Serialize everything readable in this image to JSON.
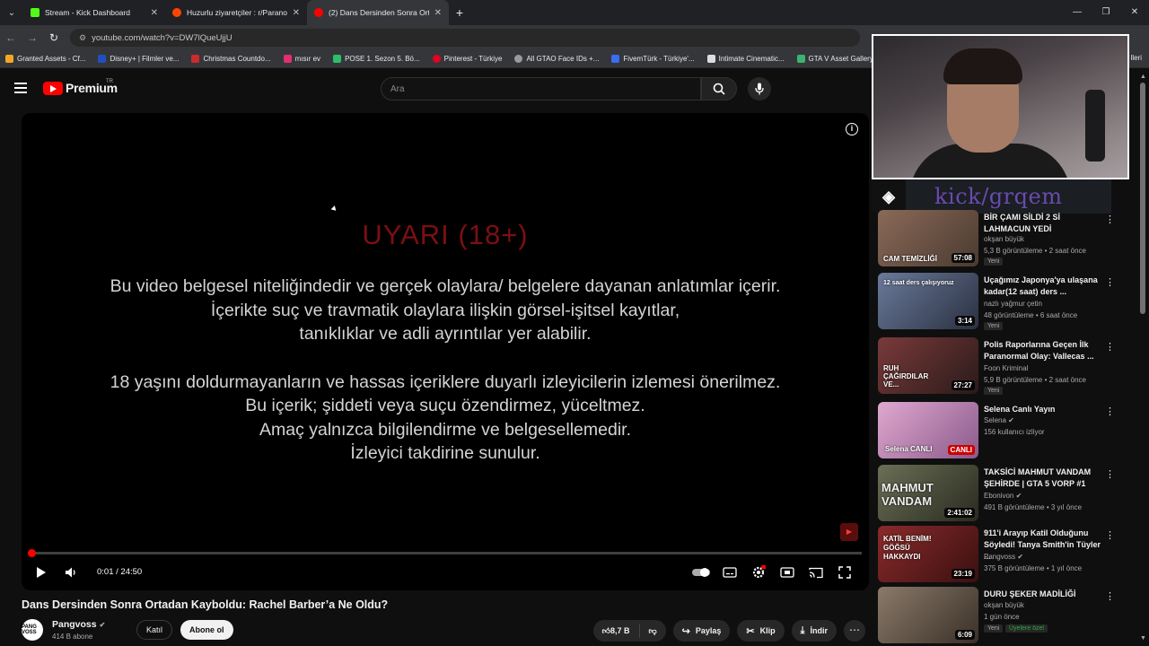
{
  "browser": {
    "tabs": [
      {
        "title": "Stream - Kick Dashboard",
        "icon": "kick-icon",
        "color": "#53fc18"
      },
      {
        "title": "Huzurlu ziyaretçiler : r/Paranorm",
        "icon": "reddit-icon",
        "color": "#ff4500"
      },
      {
        "title": "(2) Dans Dersinden Sonra Ortad",
        "icon": "youtube-icon",
        "color": "#ff0000"
      }
    ],
    "url": "youtube.com/watch?v=DW7lQueUjjU",
    "bookmarks": [
      {
        "label": "Granted Assets - Cf...",
        "color": "#f5a623"
      },
      {
        "label": "Disney+ | Filmler ve...",
        "color": "#1f4fc2"
      },
      {
        "label": "Christmas Countdo...",
        "color": "#cc2b2b"
      },
      {
        "label": "mısır ev",
        "color": "#e1306c"
      },
      {
        "label": "POSE 1. Sezon 5. Bö...",
        "color": "#2bbf6a"
      },
      {
        "label": "Pinterest - Türkiye",
        "color": "#e60023"
      },
      {
        "label": "All GTAO Face IDs +...",
        "color": "#9a9a9a"
      },
      {
        "label": "FivemTürk - Türkiye'...",
        "color": "#3a6df0"
      },
      {
        "label": "Intimate Cinematic...",
        "color": "#dddddd"
      },
      {
        "label": "GTA V Asset Gallery",
        "color": "#3cb371"
      }
    ],
    "bookmarks_more": "lleri"
  },
  "youtube": {
    "logo": "Premium",
    "logo_country": "TR",
    "search_placeholder": "Ara",
    "player": {
      "warning_title": "UYARI (18+)",
      "warning_lines_1": [
        "Bu video belgesel niteliğindedir ve gerçek olaylara/ belgelere dayanan anlatımlar içerir.",
        "İçerikte suç ve travmatik olaylara ilişkin görsel-işitsel kayıtlar,",
        "tanıklıklar ve adli ayrıntılar yer alabilir."
      ],
      "warning_lines_2": [
        "18 yaşını doldurmayanların ve hassas içeriklere duyarlı izleyicilerin izlemesi önerilmez.",
        "Bu içerik; şiddeti veya suçu özendirmez, yüceltmez.",
        "Amaç yalnızca bilgilendirme ve belgesellemedir.",
        "İzleyici takdirine sunulur."
      ],
      "time": "0:01 / 24:50",
      "progress_fraction": 0.001
    },
    "video": {
      "title": "Dans Dersinden Sonra Ortadan Kayboldu: Rachel Barber’a Ne Oldu?",
      "channel": "Pangvoss",
      "avatar_text": "PANG VOSS",
      "subscribers": "414 B abone",
      "join_label": "Katıl",
      "subscribe_label": "Abone ol",
      "likes": "8,7 B",
      "share_label": "Paylaş",
      "clip_label": "Klip",
      "download_label": "İndir"
    },
    "overlay": {
      "kick_text": "kick/grqem"
    },
    "recommendations": [
      {
        "title_line": "BİR ÇAMI SİLDİ 2 Sİ",
        "title": "LAHMACUN YEDİ",
        "channel": "okşan büyük",
        "meta": "5,3 B görüntüleme • 2 saat önce",
        "badge": "Yeni",
        "duration": "57:08",
        "thumb_text": "CAM TEMİZLİĞİ",
        "thumb_color": "#7b5a4a"
      },
      {
        "title": "Uçağımız Japonya'ya ulaşana kadar(12 saat) ders ...",
        "channel": "nazlı yağmur çetin",
        "meta": "48 görüntüleme • 6 saat önce",
        "badge": "Yeni",
        "duration": "3:14",
        "thumb_text": "12 saat ders çalışıyoruz",
        "thumb_color": "#3a4a6a"
      },
      {
        "title": "Polis Raporlarına Geçen İlk Paranormal Olay: Vallecas ...",
        "channel": "Foon Kriminal",
        "meta": "5,9 B görüntüleme • 2 saat önce",
        "badge": "Yeni",
        "duration": "27:27",
        "thumb_text": "RUH ÇAĞIRDILAR VE...",
        "thumb_color": "#5a2a2a"
      },
      {
        "title": "Selena Canlı Yayın",
        "channel": "Selena",
        "meta": "156 kullanıcı izliyor",
        "badge": "",
        "duration": "CANLI",
        "thumb_text": "Selena CANLI",
        "thumb_color": "#c58ab5"
      },
      {
        "title": "TAKSİCİ MAHMUT VANDAM ŞEHİRDE | GTA 5 VORP #1",
        "channel": "Ebonivon",
        "meta": "491 B görüntüleme • 3 yıl önce",
        "badge": "",
        "duration": "2:41:02",
        "thumb_text": "MAHMUT VANDAM",
        "thumb_color": "#4a4f3a"
      },
      {
        "title": "911'i Arayıp Katil Olduğunu Söyledi! Tanya Smith'in Tüyler ...",
        "channel": "Pangvoss",
        "meta": "375 B görüntüleme • 1 yıl önce",
        "badge": "",
        "duration": "23:19",
        "thumb_text": "KATİL BENİM! GÖĞSÜ HAKKAYDI",
        "thumb_color": "#6a2020"
      },
      {
        "title": "DURU ŞEKER MADİLİĞİ",
        "channel": "okşan büyük",
        "meta": "1 gün önce",
        "badge": "Yeni",
        "badge2": "Üyelere özel",
        "duration": "6:09",
        "thumb_text": "",
        "thumb_color": "#6a5a4a"
      }
    ]
  }
}
